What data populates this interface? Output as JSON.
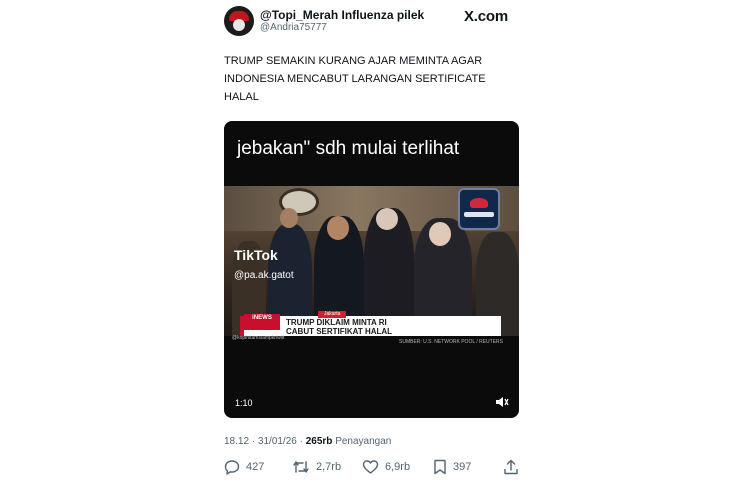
{
  "author": {
    "display_name": "@Topi_Merah Influenza pilek",
    "handle": "@Andria75777"
  },
  "brand": "X.com",
  "tweet": {
    "lines": [
      "TRUMP SEMAKIN KURANG AJAR MEMINTA AGAR",
      "INDONESIA MENCABUT LARANGAN SERTIFICATE",
      "HALAL"
    ]
  },
  "video": {
    "caption": "jebakan\" sdh mulai terlihat",
    "tiktok_label": "TikTok",
    "tiktok_user": "@pa.ak.gatot",
    "tiktok_user_bottom": "@kopihitamsiampkriwiit",
    "news_brand": "iNEWS",
    "news_place": "Jakarta",
    "news_headline_1": "TRUMP DIKLAIM MINTA RI",
    "news_headline_2": "CABUT SERTIFIKAT HALAL",
    "source_credit": "SUMBER: U.S. NETWORK POOL / REUTERS",
    "duration": "1:10",
    "volume_icon": "speaker-icon"
  },
  "meta": {
    "time": "18.12 · 31/01/26 · ",
    "views": "265rb",
    "views_label": " Penayangan"
  },
  "actions": {
    "replies": "427",
    "reposts": "2,7rb",
    "likes": "6,9rb",
    "bookmarks": "397"
  },
  "colors": {
    "text": "#0f1419",
    "muted": "#536471",
    "news_red": "#c8102e"
  }
}
